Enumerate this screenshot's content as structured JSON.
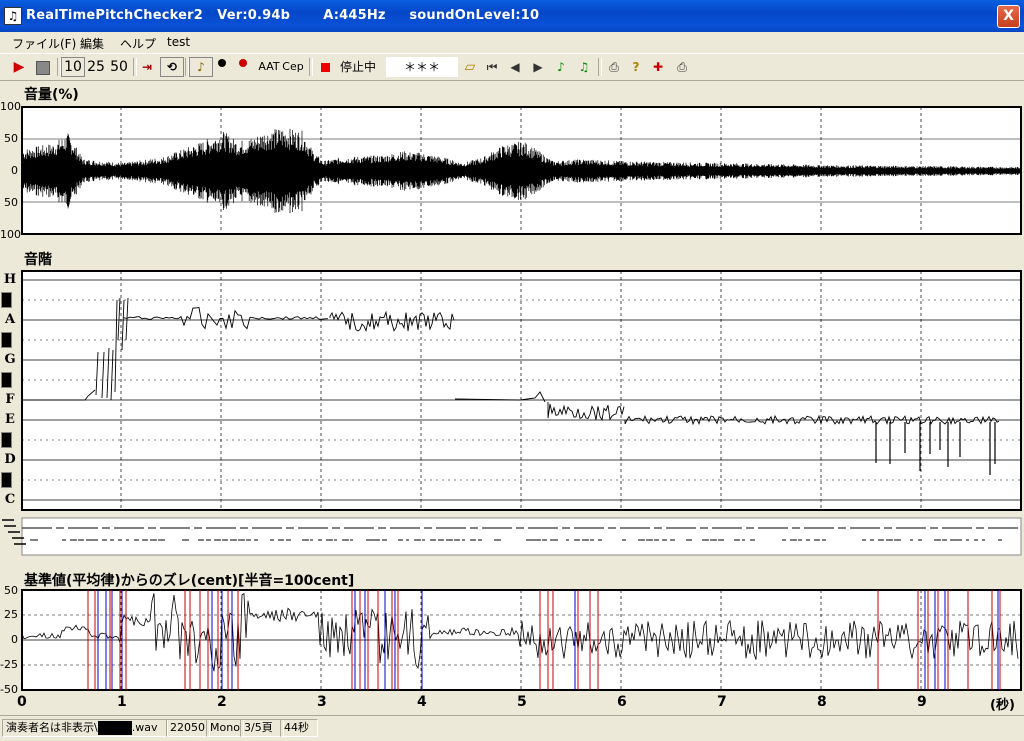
{
  "window": {
    "title": "RealTimePitchChecker2   Ver:0.94b       A:445Hz     soundOnLevel:10",
    "close_label": "X"
  },
  "menu": [
    "ファイル(F)",
    "編集",
    "ヘルプ",
    "test"
  ],
  "toolbar": {
    "play_icon": "play-icon",
    "stop_icon": "stop-icon",
    "zoom_10": "10",
    "zoom_25": "25",
    "zoom_50": "50",
    "aat_label": "AAT",
    "cep_label": "Cep",
    "status_label": "停止中",
    "note_display": "＊＊＊"
  },
  "volume_panel": {
    "title": "音量(%)",
    "y_labels": [
      "100",
      "50",
      "0",
      "50",
      "100"
    ]
  },
  "scale_panel": {
    "title": "音階",
    "notes": [
      "H",
      "A",
      "G",
      "F",
      "E",
      "D",
      "C"
    ]
  },
  "deviation_panel": {
    "title": "基準値(平均律)からのズレ(cent)[半音=100cent]",
    "y_labels": [
      "50",
      "25",
      "0",
      "-25",
      "-50"
    ]
  },
  "time_axis": {
    "labels": [
      "0",
      "1",
      "2",
      "3",
      "4",
      "5",
      "6",
      "7",
      "8",
      "9"
    ],
    "unit": "(秒)"
  },
  "statusbar": {
    "file": "演奏者名は非表示\\",
    "ext": ".wav",
    "rate": "22050",
    "channels": "Mono",
    "page": "3/5頁",
    "duration": "44秒"
  },
  "colors": {
    "title_bar": "#0a52d8",
    "red_marker": "#cc0000",
    "blue_marker": "#0000cc"
  }
}
